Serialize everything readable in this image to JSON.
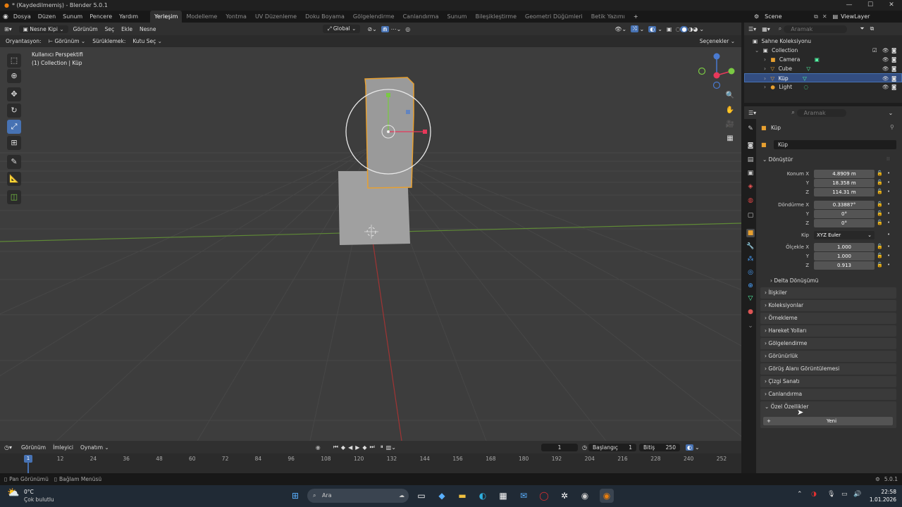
{
  "window": {
    "title": "* (Kaydedilmemiş) - Blender 5.0.1"
  },
  "menu": {
    "items": [
      "Dosya",
      "Düzen",
      "Sunum",
      "Pencere",
      "Yardım"
    ]
  },
  "workspaces": [
    "Yerleşim",
    "Modelleme",
    "Yontma",
    "UV Düzenleme",
    "Doku Boyama",
    "Gölgelendirme",
    "Canlandırma",
    "Sunum",
    "Bileşikleştirme",
    "Geometri Düğümleri",
    "Betik Yazımı"
  ],
  "scene": {
    "name": "Scene",
    "viewlayer": "ViewLayer"
  },
  "header": {
    "mode": "Nesne Kipi",
    "view": "Görünüm",
    "select": "Seç",
    "add": "Ekle",
    "object": "Nesne",
    "transform": "Global"
  },
  "toolsettings": {
    "orientation_label": "Oryantasyon:",
    "orientation": "Görünüm",
    "drag_label": "Sürüklemek:",
    "drag": "Kutu Seç",
    "options": "Seçenekler"
  },
  "viewport": {
    "perspective": "Kullanıcı Perspektifi",
    "collection": "(1) Collection | Küp"
  },
  "outliner": {
    "search_placeholder": "Aramak",
    "root": "Sahne Koleksiyonu",
    "collection": "Collection",
    "items": [
      "Camera",
      "Cube",
      "Küp",
      "Light"
    ]
  },
  "properties": {
    "search_placeholder": "Aramak",
    "object_name": "Küp",
    "mesh_name": "Küp",
    "section": "Dönüştür",
    "location": {
      "label": "Konum X",
      "x": "4.8909 m",
      "y": "18.358 m",
      "z": "114.31 m"
    },
    "rotation": {
      "label": "Döndürme X",
      "x": "0.33887°",
      "y": "0°",
      "z": "0°"
    },
    "mode": {
      "label": "Kip",
      "value": "XYZ Euler"
    },
    "scale": {
      "label": "Ölçekle X",
      "x": "1.000",
      "y": "1.000",
      "z": "0.913"
    },
    "axis": {
      "y": "Y",
      "z": "Z"
    },
    "delta": "Delta Dönüşümü",
    "panels": [
      "İlişkiler",
      "Koleksiyonlar",
      "Örnekleme",
      "Hareket Yolları",
      "Gölgelendirme",
      "Görünürlük",
      "Görüş Alanı Görüntülemesi",
      "Çizgi Sanatı",
      "Canlandırma",
      "Özel Özellikler"
    ],
    "new_button": "Yeni"
  },
  "timeline": {
    "view": "Görünüm",
    "marker": "İmleyici",
    "play": "Oynatım",
    "current_frame": "1",
    "start_label": "Başlangıç",
    "start": "1",
    "end_label": "Bitiş",
    "end": "250",
    "ticks": [
      "12",
      "24",
      "36",
      "48",
      "60",
      "72",
      "84",
      "96",
      "108",
      "120",
      "132",
      "144",
      "156",
      "168",
      "180",
      "192",
      "204",
      "216",
      "228",
      "240",
      "252"
    ],
    "playhead": "1"
  },
  "statusbar": {
    "pan": "Pan Görünümü",
    "context": "Bağlam Menüsü",
    "version": "5.0.1"
  },
  "taskbar": {
    "temp": "0°C",
    "weather": "Çok bulutlu",
    "search": "Ara",
    "time": "22:58",
    "date": "1.01.2026"
  },
  "colors": {
    "accent": "#4772b3",
    "selection": "#e8a030",
    "grid": "#4a4a4a"
  }
}
